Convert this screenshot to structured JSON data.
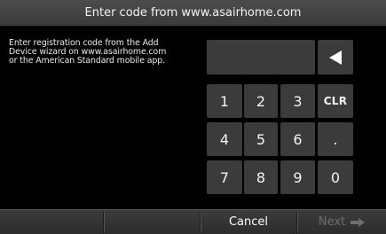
{
  "header": {
    "title": "Enter code from www.asairhome.com"
  },
  "instructions": {
    "line1": "Enter registration code from the Add",
    "line2": "Device wizard on www.asairhome.com",
    "line3": "or the American Standard mobile app."
  },
  "code_entry": {
    "value": ""
  },
  "keypad": {
    "keys": [
      "1",
      "2",
      "3",
      "CLR",
      "4",
      "5",
      "6",
      ".",
      "7",
      "8",
      "9",
      "0"
    ],
    "backspace_icon": "backspace-arrow-icon"
  },
  "footer": {
    "cancel_label": "Cancel",
    "next_label": "Next",
    "next_enabled": false,
    "next_icon": "right-arrow-icon"
  },
  "colors": {
    "background": "#000000",
    "key": "#3b3b3b",
    "bar": "#3c3c3c",
    "text": "#ffffff",
    "disabled_text": "#6e6e6e"
  }
}
